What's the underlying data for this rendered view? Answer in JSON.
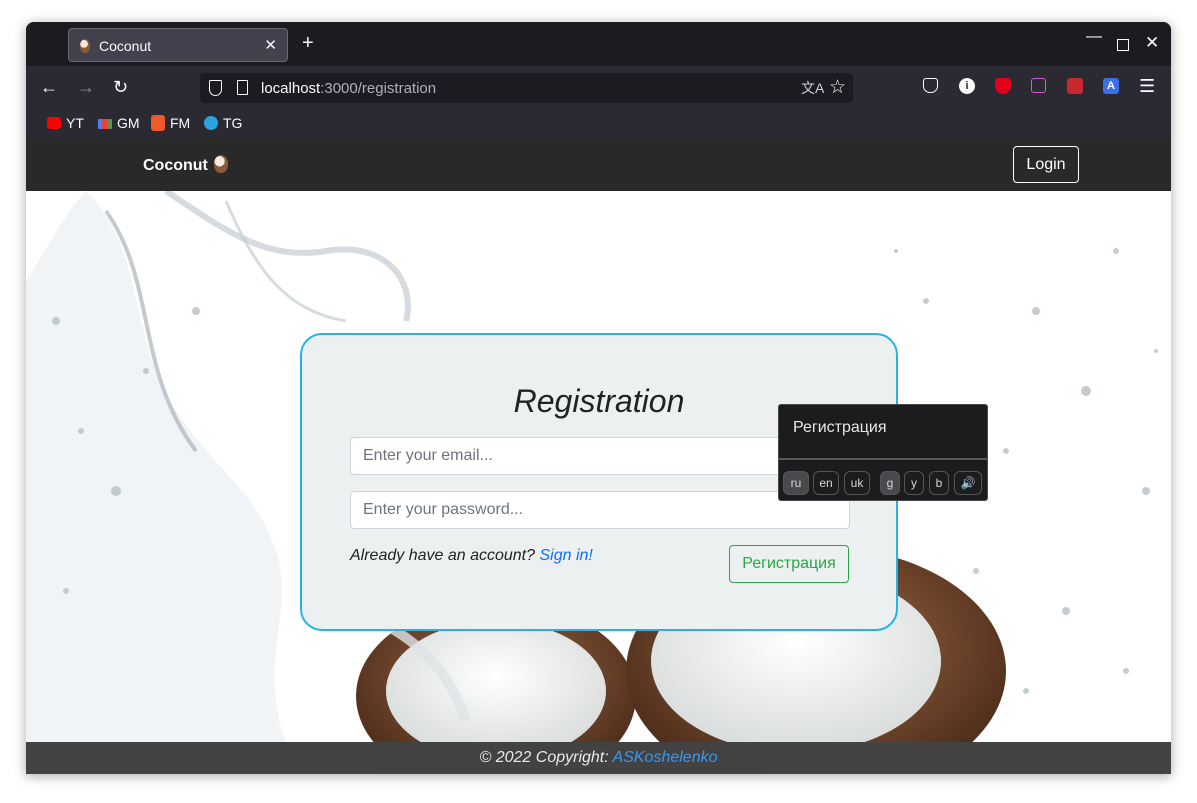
{
  "browser": {
    "tab_title": "Coconut",
    "url_host": "localhost",
    "url_path": ":3000/registration",
    "bookmarks": [
      {
        "label": "YT"
      },
      {
        "label": "GM"
      },
      {
        "label": "FM"
      },
      {
        "label": "TG"
      }
    ]
  },
  "site": {
    "brand": "Coconut",
    "login_label": "Login"
  },
  "form": {
    "title": "Registration",
    "email_placeholder": "Enter your email...",
    "password_placeholder": "Enter your password...",
    "signin_prompt": "Already have an account? ",
    "signin_link": "Sign in!",
    "submit_label": "Регистрация"
  },
  "translation_popup": {
    "text": "Регистрация",
    "langs": [
      "ru",
      "en",
      "uk"
    ],
    "engines": [
      "g",
      "y",
      "b"
    ]
  },
  "footer": {
    "copyright": "© 2022 Copyright: ",
    "author": "ASKoshelenko"
  },
  "colors": {
    "accent_border": "#22b4e8",
    "submit_green": "#28a745",
    "link_blue": "#0d6efd",
    "header_bg": "#292929"
  }
}
